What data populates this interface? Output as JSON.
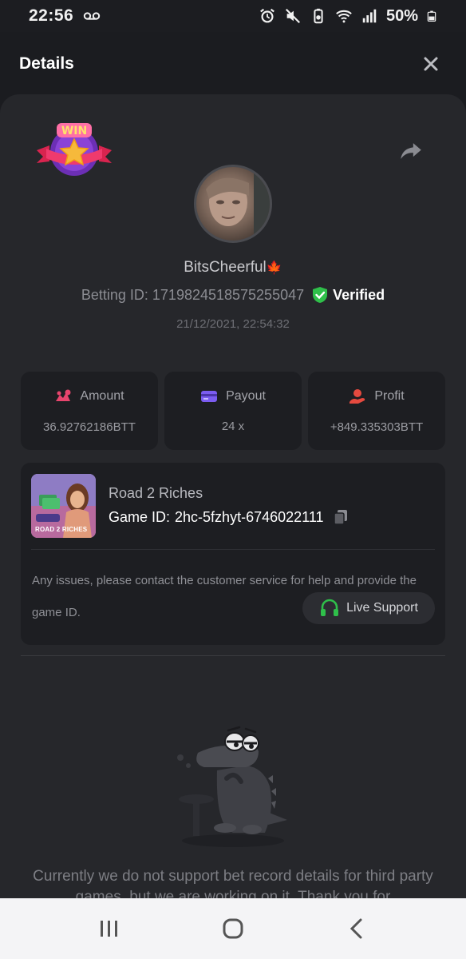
{
  "status_bar": {
    "time": "22:56",
    "battery": "50%",
    "icons": [
      "voicemail-icon",
      "alarm-icon",
      "mute-icon",
      "battery-saver-icon",
      "wifi-icon",
      "signal-icon",
      "battery-icon"
    ]
  },
  "header": {
    "title": "Details",
    "close_icon": "close-icon"
  },
  "profile": {
    "badge": "WIN",
    "username": "BitsCheerful",
    "username_emoji": "🍁",
    "betting_id_label": "Betting ID:",
    "betting_id": "1719824518575255047",
    "verified_label": "Verified",
    "timestamp": "21/12/2021, 22:54:32"
  },
  "stats": [
    {
      "label": "Amount",
      "value": "36.92762186BTT",
      "icon": "amount-icon",
      "color": "#e8456d"
    },
    {
      "label": "Payout",
      "value": "24 x",
      "icon": "payout-card-icon",
      "color": "#7b5cf0"
    },
    {
      "label": "Profit",
      "value": "+849.335303BTT",
      "icon": "profit-icon",
      "color": "#e64a3f"
    }
  ],
  "game": {
    "name": "Road 2 Riches",
    "thumb_label": "ROAD 2 RICHES",
    "id_label": "Game ID:",
    "id": "2hc-5fzhyt-6746022111",
    "notice": "Any issues, please contact the customer service for help and provide the game ID.",
    "support_label": "Live Support"
  },
  "empty_state": {
    "message": "Currently we do not support bet record details for third party games, but we are working on it. Thank you for"
  },
  "nav": {
    "recents": "recents-icon",
    "home": "home-icon",
    "back": "back-icon"
  },
  "colors": {
    "background": "#1b1c20",
    "sheet": "#26272b",
    "card": "#1d1e22",
    "verified_green": "#2fbf4a",
    "support_green": "#2fbf4a"
  }
}
